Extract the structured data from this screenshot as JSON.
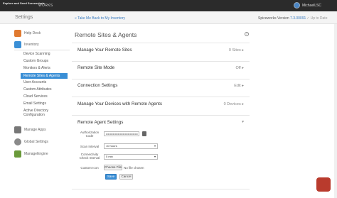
{
  "topbar": {
    "brand_line1": "Explore and Send Screenshots",
    "brand_logo": "WORKS",
    "user": "MichaelLSC"
  },
  "subbar": {
    "title": "Settings",
    "back_link": "« Take Me Back to My Inventory",
    "version_prefix": "Spiceworks Version ",
    "version": "7.3.00091",
    "up_to_date": "✓ Up to Date"
  },
  "sidebar": {
    "help_desk": "Help Desk",
    "inventory": "Inventory",
    "items": [
      "Device Scanning",
      "Custom Groups",
      "Monitors & Alerts",
      "Remote Sites & Agents",
      "User Accounts",
      "Custom Attributes",
      "Cloud Services",
      "Email Settings",
      "Active Directory",
      "Configuration"
    ],
    "manage_apps": "Manage Apps",
    "global_settings": "Global Settings",
    "manageengine": "ManageEngine"
  },
  "main": {
    "page_title": "Remote Sites & Agents",
    "help": "?",
    "sections": [
      {
        "label": "Manage Your Remote Sites",
        "value": "0 Sites ▸"
      },
      {
        "label": "Remote Site Mode",
        "value": "Off ▸"
      },
      {
        "label": "Connection Settings",
        "value": "Edit ▸"
      },
      {
        "label": "Manage Your Devices with Remote Agents",
        "value": "0 Devices ▸"
      },
      {
        "label": "Remote Agent Settings",
        "value": "▾"
      }
    ],
    "form": {
      "auth_code_label": "Authorization Code",
      "auth_code_value": "••••••••••••••••••••••••••••••••",
      "scan_interval_label": "Scan Interval",
      "scan_interval_value": "10 hours",
      "connectivity_label": "Connectivity Check Interval",
      "connectivity_value": "5 min",
      "custom_icon_label": "Custom Icon",
      "choose_file": "Choose File",
      "no_file": "No file chosen",
      "save": "Save",
      "cancel": "Cancel"
    }
  },
  "colors": {
    "topbar": "#2b2b2b",
    "accent": "#3a8fd6",
    "link": "#3a7cc0"
  }
}
